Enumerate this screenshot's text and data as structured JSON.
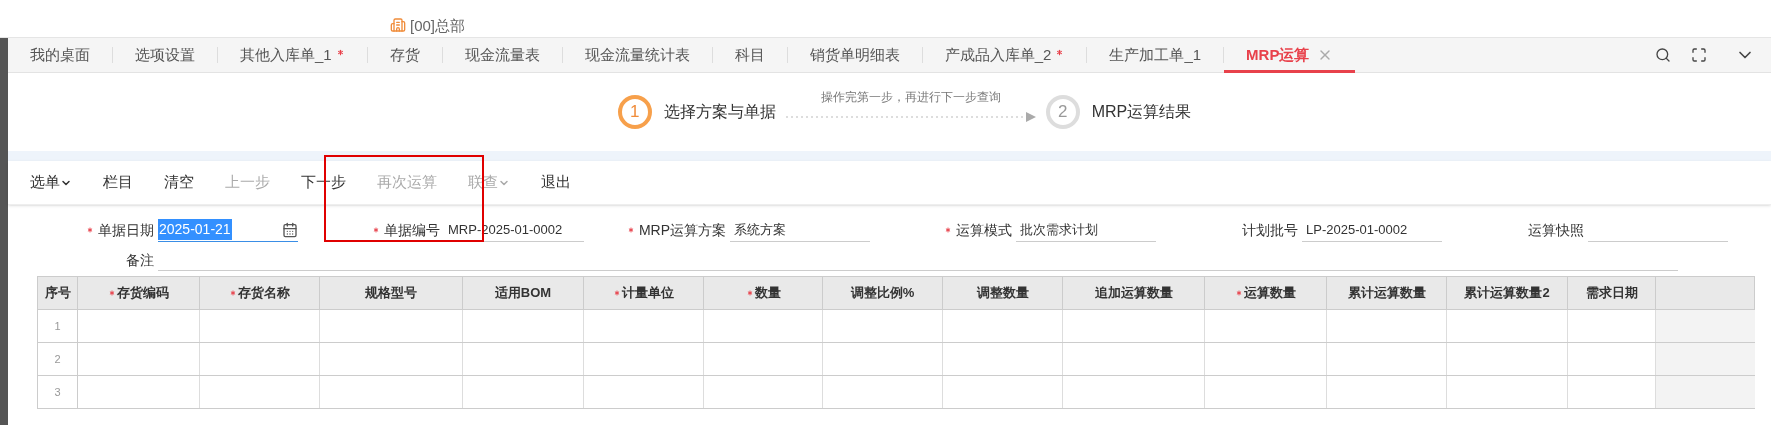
{
  "header": {
    "org": "[00]总部"
  },
  "tabs": [
    {
      "label": "我的桌面",
      "modified": false,
      "selected": false
    },
    {
      "label": "选项设置",
      "modified": false,
      "selected": false
    },
    {
      "label": "其他入库单_1",
      "modified": true,
      "selected": false
    },
    {
      "label": "存货",
      "modified": false,
      "selected": false
    },
    {
      "label": "现金流量表",
      "modified": false,
      "selected": false
    },
    {
      "label": "现金流量统计表",
      "modified": false,
      "selected": false
    },
    {
      "label": "科目",
      "modified": false,
      "selected": false
    },
    {
      "label": "销货单明细表",
      "modified": false,
      "selected": false
    },
    {
      "label": "产成品入库单_2",
      "modified": true,
      "selected": false
    },
    {
      "label": "生产加工单_1",
      "modified": false,
      "selected": false
    },
    {
      "label": "MRP运算",
      "modified": false,
      "selected": true
    }
  ],
  "steps": [
    {
      "number": "1",
      "label": "选择方案与单据",
      "active": true
    },
    {
      "number": "2",
      "label": "MRP运算结果",
      "active": false
    }
  ],
  "step_hint": "操作完第一步，再进行下一步查询",
  "toolbar": [
    {
      "label": "选单",
      "dropdown": true,
      "disabled": false
    },
    {
      "label": "栏目",
      "dropdown": false,
      "disabled": false
    },
    {
      "label": "清空",
      "dropdown": false,
      "disabled": false
    },
    {
      "label": "上一步",
      "dropdown": false,
      "disabled": true
    },
    {
      "label": "下一步",
      "dropdown": false,
      "disabled": false
    },
    {
      "label": "再次运算",
      "dropdown": false,
      "disabled": true
    },
    {
      "label": "联查",
      "dropdown": true,
      "disabled": true
    },
    {
      "label": "退出",
      "dropdown": false,
      "disabled": false
    }
  ],
  "form": [
    {
      "label": "单据日期",
      "required": true,
      "kind": "date",
      "value": "2025-01-21"
    },
    {
      "label": "单据编号",
      "required": true,
      "kind": "text",
      "value": "MRP-2025-01-0002"
    },
    {
      "label": "MRP运算方案",
      "required": true,
      "kind": "text",
      "value": "系统方案"
    },
    {
      "label": "运算模式",
      "required": true,
      "kind": "text",
      "value": "批次需求计划"
    },
    {
      "label": "计划批号",
      "required": false,
      "kind": "text",
      "value": "LP-2025-01-0002"
    },
    {
      "label": "运算快照",
      "required": false,
      "kind": "text"
    }
  ],
  "remark": {
    "label": "备注"
  },
  "table": {
    "columns": [
      {
        "label": "序号",
        "required": false
      },
      {
        "label": "存货编码",
        "required": true
      },
      {
        "label": "存货名称",
        "required": true
      },
      {
        "label": "规格型号",
        "required": false
      },
      {
        "label": "适用BOM",
        "required": false
      },
      {
        "label": "计量单位",
        "required": true
      },
      {
        "label": "数量",
        "required": true
      },
      {
        "label": "调整比例%",
        "required": false
      },
      {
        "label": "调整数量",
        "required": false
      },
      {
        "label": "追加运算数量",
        "required": false
      },
      {
        "label": "运算数量",
        "required": true
      },
      {
        "label": "累计运算数量",
        "required": false
      },
      {
        "label": "累计运算数量2",
        "required": false
      },
      {
        "label": "需求日期",
        "required": false
      }
    ],
    "rows": [
      "1",
      "2",
      "3"
    ]
  }
}
